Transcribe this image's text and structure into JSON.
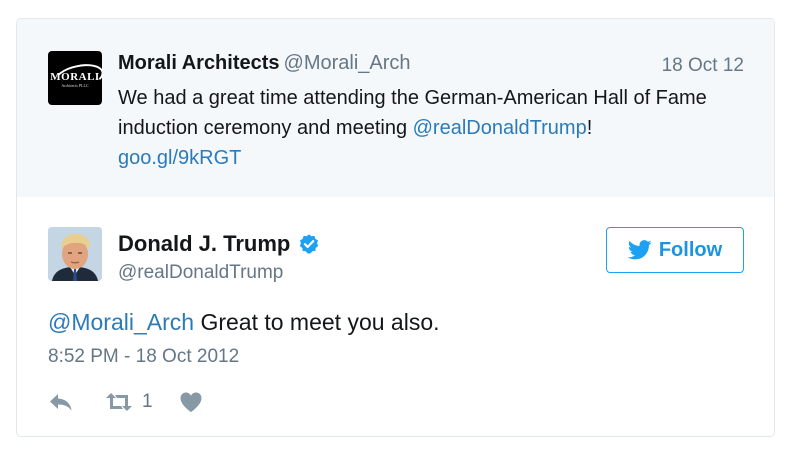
{
  "quoted_tweet": {
    "logo_text": "MORALI",
    "logo_subtext": "Architects PLLC",
    "display_name": "Morali Architects",
    "handle": "@Morali_Arch",
    "date": "18 Oct 12",
    "text_before": "We had a great time attending the German-American Hall of Fame induction ceremony and meeting ",
    "mention": "@realDonaldTrump",
    "text_after": "!",
    "link": "goo.gl/9kRGT"
  },
  "tweet": {
    "display_name": "Donald J. Trump",
    "handle": "@realDonaldTrump",
    "follow_label": "Follow",
    "reply_mention": "@Morali_Arch",
    "text": " Great to meet you also.",
    "timestamp": "8:52 PM - 18 Oct 2012",
    "retweet_count": "1"
  },
  "colors": {
    "link": "#2b7bb9",
    "twitter_blue": "#1da1f2",
    "muted": "#657786",
    "quoted_bg": "#f5f8fa"
  },
  "icons": [
    "verified-badge-icon",
    "twitter-bird-icon",
    "reply-icon",
    "retweet-icon",
    "heart-icon"
  ]
}
